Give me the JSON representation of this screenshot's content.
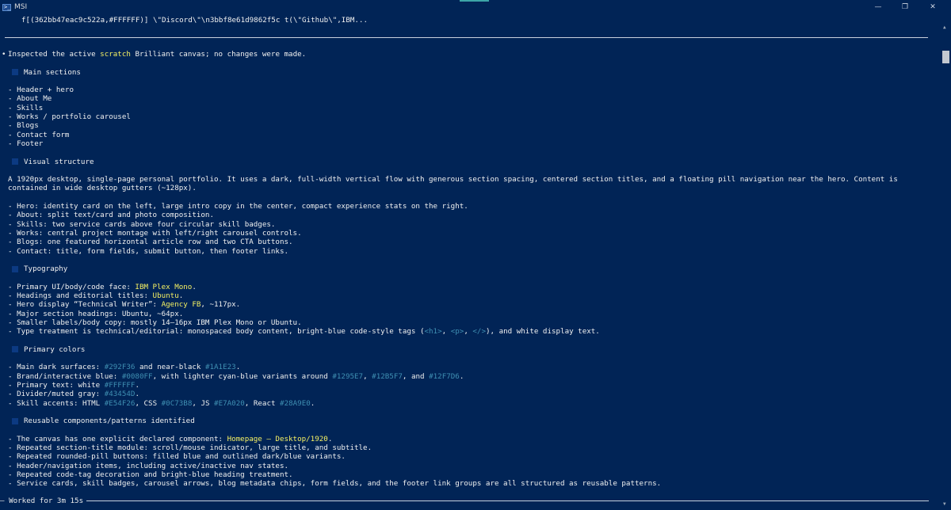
{
  "window": {
    "title": "MSI",
    "icon": "powershell-icon",
    "minimize": "—",
    "maximize": "❐",
    "close": "✕"
  },
  "top_command": "f[(362bb47eac9c522a,#FFFFFF)] \\\"Discord\\\"\\n3bbf8e61d9862f5c t(\\\"Github\\\",IBM...",
  "intro": {
    "before": "Inspected the active ",
    "highlight": "scratch",
    "after": " Brilliant canvas; no changes were made."
  },
  "sections": {
    "main": {
      "title": "Main sections",
      "items": [
        "- Header + hero",
        "- About Me",
        "- Skills",
        "- Works / portfolio carousel",
        "- Blogs",
        "- Contact form",
        "- Footer"
      ]
    },
    "visual": {
      "title": "Visual structure",
      "paragraph": "A 1920px desktop, single-page personal portfolio. It uses a dark, full-width vertical flow with generous section spacing, centered section titles, and a floating pill navigation near the hero. Content is contained in wide desktop gutters (~128px).",
      "items": [
        "- Hero: identity card on the left, large intro copy in the center, compact experience stats on the right.",
        "- About: split text/card and photo composition.",
        "- Skills: two service cards above four circular skill badges.",
        "- Works: central project montage with left/right carousel controls.",
        "- Blogs: one featured horizontal article row and two CTA buttons.",
        "- Contact: title, form fields, submit button, then footer links."
      ]
    },
    "typography": {
      "title": "Typography",
      "l1_before": "- Primary UI/body/code face: ",
      "l1_hl": "IBM Plex Mono",
      "l1_after": ".",
      "l2_before": "- Headings and editorial titles: ",
      "l2_hl": "Ubuntu",
      "l2_after": ".",
      "l3_before": "- Hero display “Technical Writer”: ",
      "l3_hl": "Agency FB",
      "l3_after": ", ~117px.",
      "l4": "- Major section headings: Ubuntu, ~64px.",
      "l5": "- Smaller labels/body copy: mostly 14–16px IBM Plex Mono or Ubuntu.",
      "l6_before": "- Type treatment is technical/editorial: monospaced body content, bright-blue code-style tags (",
      "l6_tag1": "<h1>",
      "l6_sep1": ", ",
      "l6_tag2": "<p>",
      "l6_sep2": ", ",
      "l6_tag3": "</>",
      "l6_after": "), and white display text."
    },
    "colors": {
      "title": "Primary colors",
      "l1_before": "- Main dark surfaces: ",
      "l1_c1": "#292F36",
      "l1_mid": " and near-black ",
      "l1_c2": "#1A1E23",
      "l1_after": ".",
      "l2_before": "- Brand/interactive blue: ",
      "l2_c1": "#0080FF",
      "l2_mid": ", with lighter cyan-blue variants around ",
      "l2_c2": "#1295E7",
      "l2_sep": ", ",
      "l2_c3": "#12B5F7",
      "l2_and": ", and ",
      "l2_c4": "#12F7D6",
      "l2_after": ".",
      "l3_before": "- Primary text: white ",
      "l3_c1": "#FFFFFF",
      "l3_after": ".",
      "l4_before": "- Divider/muted gray: ",
      "l4_c1": "#43454D",
      "l4_after": ".",
      "l5_before": "- Skill accents: HTML ",
      "l5_c1": "#E54F26",
      "l5_css": ", CSS ",
      "l5_c2": "#0C73B8",
      "l5_js": ", JS ",
      "l5_c3": "#E7A020",
      "l5_react": ", React ",
      "l5_c4": "#28A9E0",
      "l5_after": "."
    },
    "components": {
      "title": "Reusable components/patterns identified",
      "l1_before": "- The canvas has one explicit declared component: ",
      "l1_hl": "Homepage – Desktop/1920",
      "l1_after": ".",
      "items": [
        "- Repeated section-title module: scroll/mouse indicator, large title, and subtitle.",
        "- Repeated rounded-pill buttons: filled blue and outlined dark/blue variants.",
        "- Header/navigation items, including active/inactive nav states.",
        "- Repeated code-tag decoration and bright-blue heading treatment.",
        "- Service cards, skill badges, carousel arrows, blog metadata chips, form fields, and the footer link groups are all structured as reusable patterns."
      ]
    }
  },
  "footer": "— Worked for 3m 15s",
  "colors": {
    "background": "#012456",
    "highlight_yellow": "#F5F063",
    "highlight_cyan": "#3F8FB2",
    "section_marker": "#0C3A82"
  }
}
